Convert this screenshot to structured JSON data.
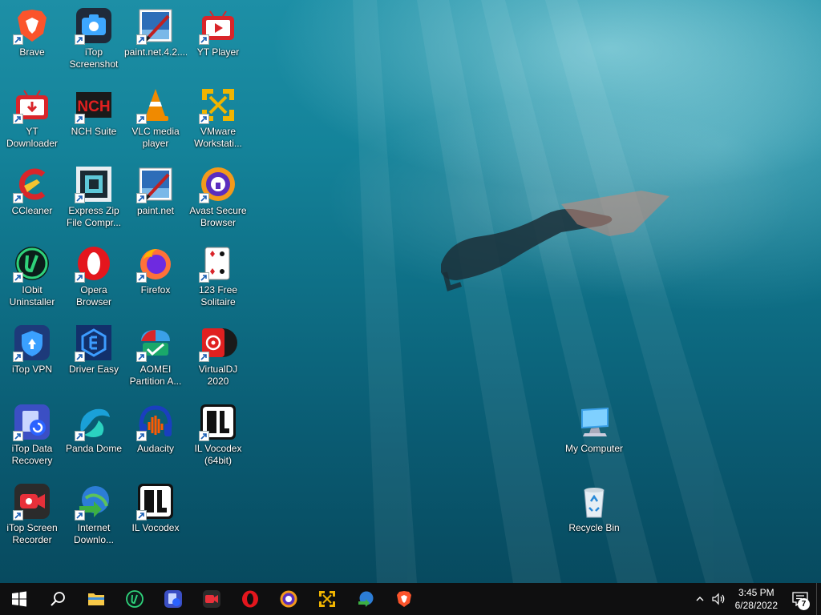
{
  "desktop": {
    "icons": [
      {
        "label": "Brave"
      },
      {
        "label": "iTop\nScreenshot"
      },
      {
        "label": "paint.net.4.2...."
      },
      {
        "label": "YT Player"
      },
      {
        "label": "YT\nDownloader"
      },
      {
        "label": "NCH Suite"
      },
      {
        "label": "VLC media\nplayer"
      },
      {
        "label": "VMware\nWorkstati..."
      },
      {
        "label": "CCleaner"
      },
      {
        "label": "Express Zip\nFile Compr..."
      },
      {
        "label": "paint.net"
      },
      {
        "label": "Avast Secure\nBrowser"
      },
      {
        "label": "IObit\nUninstaller"
      },
      {
        "label": "Opera\nBrowser"
      },
      {
        "label": "Firefox"
      },
      {
        "label": "123 Free\nSolitaire"
      },
      {
        "label": "iTop VPN"
      },
      {
        "label": "Driver Easy"
      },
      {
        "label": "AOMEI\nPartition A..."
      },
      {
        "label": "VirtualDJ 2020"
      },
      {
        "label": "iTop Data\nRecovery"
      },
      {
        "label": "Panda Dome"
      },
      {
        "label": "Audacity"
      },
      {
        "label": "IL Vocodex\n(64bit)"
      },
      {
        "label": "iTop Screen\nRecorder"
      },
      {
        "label": "Internet\nDownlo..."
      },
      {
        "label": "IL Vocodex"
      },
      {
        "label": "My Computer"
      },
      {
        "label": "Recycle Bin"
      }
    ]
  },
  "taskbar": {
    "apps": [
      "start",
      "search",
      "file-explorer",
      "iobit-uninstaller",
      "itop-data-recovery",
      "itop-screen-recorder",
      "opera",
      "avast-secure-browser",
      "vmware",
      "internet-download-manager",
      "brave"
    ],
    "clock": {
      "time": "3:45 PM",
      "date": "6/28/2022"
    },
    "notifications": "7"
  },
  "colors": {
    "taskbar": "#0f0f10",
    "water_top": "#1d8fa6",
    "water_bottom": "#074a5f"
  }
}
